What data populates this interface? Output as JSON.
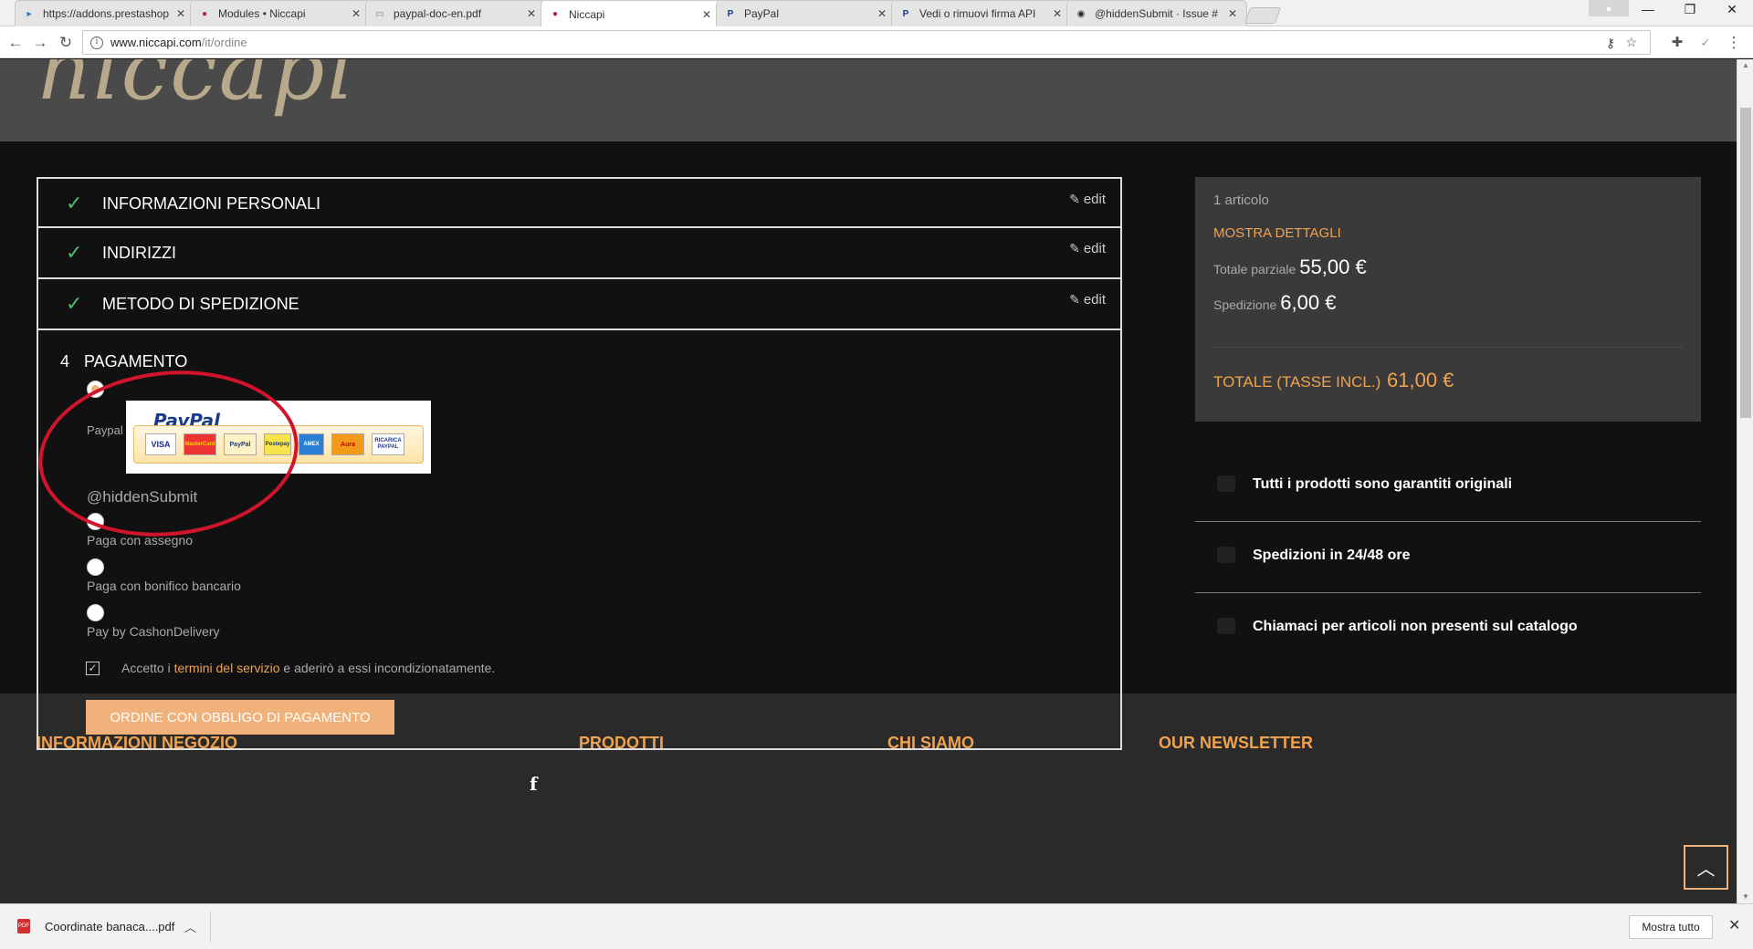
{
  "browser": {
    "tabs": [
      {
        "label": "https://addons.prestashop",
        "fav": "prestashop-icon",
        "fav_color": "#1d6fba"
      },
      {
        "label": "Modules • Niccapi",
        "fav": "niccapi-icon",
        "fav_color": "#b23"
      },
      {
        "label": "paypal-doc-en.pdf",
        "fav": "document-icon",
        "fav_color": "#777"
      },
      {
        "label": "Niccapi",
        "fav": "niccapi-icon",
        "fav_color": "#b23"
      },
      {
        "label": "PayPal",
        "fav": "paypal-icon",
        "fav_color": "#1a3a8a"
      },
      {
        "label": "Vedi o rimuovi firma API",
        "fav": "paypal-icon",
        "fav_color": "#1a3a8a"
      },
      {
        "label": "@hiddenSubmit · Issue #",
        "fav": "github-icon",
        "fav_color": "#222"
      }
    ],
    "active_tab_index": 3,
    "url_host": "www.niccapi.com",
    "url_path": "/it/ordine"
  },
  "checkout": {
    "steps": [
      {
        "title": "INFORMAZIONI PERSONALI",
        "edit": "edit"
      },
      {
        "title": "INDIRIZZI",
        "edit": "edit"
      },
      {
        "title": "METODO DI SPEDIZIONE",
        "edit": "edit"
      }
    ],
    "payment": {
      "number": "4",
      "title": "PAGAMENTO",
      "paypal_label": "Paypal",
      "paypal_logo": "PayPal",
      "paypal_cards": [
        "VISA",
        "MasterCard",
        "PayPal",
        "Postepay",
        "AMEX",
        "Aura",
        "RICARICA PAYPAL"
      ],
      "hidden_submit": "@hiddenSubmit",
      "options": [
        "Paga con assegno",
        "Paga con bonifico bancario",
        "Pay by CashonDelivery"
      ],
      "terms_prefix": "Accetto i ",
      "terms_link": "termini del servizio",
      "terms_suffix": " e aderirò a essi incondizionatamente.",
      "order_button": "ORDINE CON OBBLIGO DI PAGAMENTO"
    }
  },
  "summary": {
    "count": "1 articolo",
    "details": "MOSTRA DETTAGLI",
    "subtotal_label": "Totale parziale",
    "subtotal_value": "55,00 €",
    "shipping_label": "Spedizione",
    "shipping_value": "6,00 €",
    "total_label": "TOTALE (TASSE INCL.)",
    "total_value": "61,00 €"
  },
  "assurances": [
    {
      "text": "Tutti i prodotti sono garantiti originali",
      "icon": "shield-icon"
    },
    {
      "text": "Spedizioni in 24/48 ore",
      "icon": "truck-icon"
    },
    {
      "text": "Chiamaci per articoli non presenti sul catalogo",
      "icon": "exchange-icon"
    }
  ],
  "footer": {
    "headings": [
      "INFORMAZIONI NEGOZIO",
      "PRODOTTI",
      "CHI SIAMO",
      "OUR NEWSLETTER"
    ]
  },
  "downloads": {
    "file": "Coordinate banaca....pdf",
    "show_all": "Mostra tutto"
  },
  "colors": {
    "accent": "#f0b27a",
    "link": "#f0a24e",
    "check": "#4cbb6c",
    "annotation": "#d2142b"
  }
}
